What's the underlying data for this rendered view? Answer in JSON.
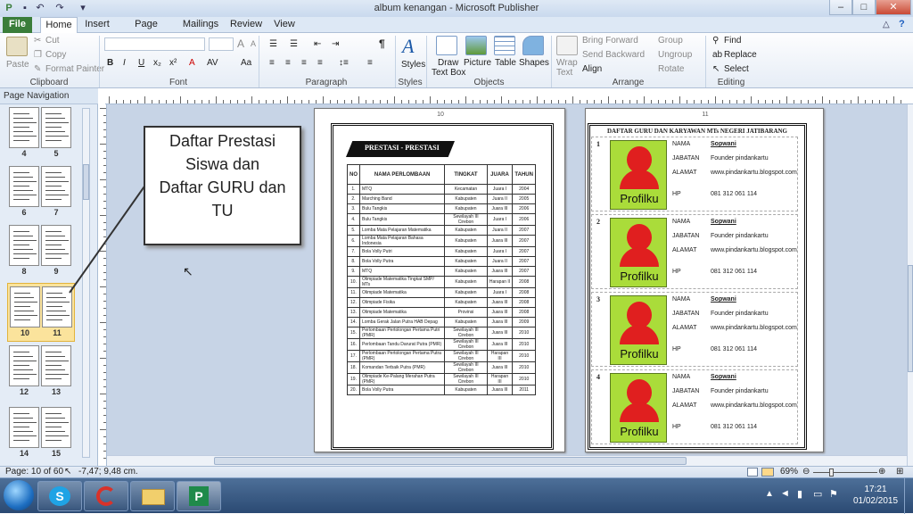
{
  "window": {
    "title": "album kenangan  -  Microsoft Publisher",
    "controls": [
      "–",
      "□",
      "✕"
    ]
  },
  "tabs": [
    "File",
    "Home",
    "Insert",
    "Page Design",
    "Mailings",
    "Review",
    "View"
  ],
  "ribbon": {
    "clipboard": {
      "group": "Clipboard",
      "paste": "Paste",
      "cut": "Cut",
      "copy": "Copy",
      "format_painter": "Format Painter"
    },
    "font": {
      "group": "Font",
      "bold": "B",
      "italic": "I",
      "underline": "U",
      "sub": "x₂",
      "super": "x²",
      "grow": "A",
      "shrink": "A"
    },
    "paragraph": {
      "group": "Paragraph",
      "pilcrow": "¶"
    },
    "styles": {
      "group": "Styles",
      "label": "Styles"
    },
    "objects": {
      "group": "Objects",
      "draw_text_box_1": "Draw",
      "draw_text_box_2": "Text Box",
      "picture": "Picture",
      "table": "Table",
      "shapes": "Shapes"
    },
    "arrange": {
      "group": "Arrange",
      "wrap_1": "Wrap",
      "wrap_2": "Text",
      "bring_forward": "Bring Forward",
      "send_backward": "Send Backward",
      "align": "Align",
      "group_btn": "Group",
      "ungroup": "Ungroup",
      "rotate": "Rotate"
    },
    "editing": {
      "group": "Editing",
      "find": "Find",
      "replace": "Replace",
      "select": "Select"
    }
  },
  "navigation": {
    "title": "Page Navigation",
    "thumbnails": [
      {
        "left": "4",
        "right": "5"
      },
      {
        "left": "6",
        "right": "7"
      },
      {
        "left": "8",
        "right": "9"
      },
      {
        "left": "10",
        "right": "11"
      },
      {
        "left": "12",
        "right": "13"
      },
      {
        "left": "14",
        "right": "15"
      }
    ]
  },
  "callout": {
    "line1": "Daftar Prestasi",
    "line2": "Siswa dan",
    "line3": "Daftar GURU dan",
    "line4": "TU"
  },
  "page_left": {
    "number": "10",
    "heading": "PRESTASI  - PRESTASI",
    "columns": [
      "NO",
      "NAMA PERLOMBAAN",
      "TINGKAT",
      "JUARA",
      "TAHUN"
    ],
    "rows": [
      [
        "1.",
        "MTQ",
        "Kecamatan",
        "Juara I",
        "2004"
      ],
      [
        "2.",
        "Marching Band",
        "Kabupaten",
        "Juara II",
        "2005"
      ],
      [
        "3.",
        "Bulu Tangkis",
        "Kabupaten",
        "Juara III",
        "2006"
      ],
      [
        "4.",
        "Bulu Tangkis",
        "Sewilayah III Cirebon",
        "Juara I",
        "2006"
      ],
      [
        "5.",
        "Lomba Mata Pelajaran Matematika",
        "Kabupaten",
        "Juara II",
        "2007"
      ],
      [
        "6.",
        "Lomba Mata Pelajaran Bahasa Indonesia",
        "Kabupaten",
        "Juara III",
        "2007"
      ],
      [
        "7.",
        "Bola Volly Putri",
        "Kabupaten",
        "Juara I",
        "2007"
      ],
      [
        "8.",
        "Bola Volly Putra",
        "Kabupaten",
        "Juara II",
        "2007"
      ],
      [
        "9.",
        "MTQ",
        "Kabupaten",
        "Juara III",
        "2007"
      ],
      [
        "10.",
        "Olimpiade Matematika Tingkat SMP/ MTs",
        "Kabupaten",
        "Harapan II",
        "2008"
      ],
      [
        "11.",
        "Olimpiade Matematika",
        "Kabupaten",
        "Juara I",
        "2008"
      ],
      [
        "12.",
        "Olimpiade Fisika",
        "Kabupaten",
        "Juara III",
        "2008"
      ],
      [
        "13.",
        "Olimpiade Matematika",
        "Provinsi",
        "Juara III",
        "2008"
      ],
      [
        "14.",
        "Lomba Gerak Jalan Putra HAB Depag",
        "Kabupaten",
        "Juara III",
        "2009"
      ],
      [
        "15.",
        "Perlombaan Pertolongan Pertama Putri (PMR)",
        "Sewilayah III Cirebon",
        "Juara III",
        "2010"
      ],
      [
        "16.",
        "Perlombaan Tandu Darurat Putra (PMR)",
        "Sewilayah III Cirebon",
        "Juara III",
        "2010"
      ],
      [
        "17.",
        "Perlombaan Pertolongan Pertama Putra  (PMR)",
        "Sewilayah III Cirebon",
        "Harapan III",
        "2010"
      ],
      [
        "18.",
        "Komandan Terbaik Putra (PMR)",
        "Sewilayah III Cirebon",
        "Juara III",
        "2010"
      ],
      [
        "19.",
        "Olimpiade Ke-Palang Merahan Putra (PMR)",
        "Sewilayah III Cirebon",
        "Harapan III",
        "2010"
      ],
      [
        "20.",
        "Bola Volly Putra",
        "Kabupaten",
        "Juara III",
        "2011"
      ]
    ]
  },
  "page_right": {
    "number": "11",
    "heading": "DAFTAR GURU DAN KARYAWAN  MTs NEGERI  JATIBARANG",
    "profiles": [
      {
        "num": "1",
        "photo": "Profilku",
        "nama_label": "NAMA",
        "nama": "Sopwani",
        "jabatan_label": "JABATAN",
        "jabatan": "Founder pindankartu",
        "alamat_label": "ALAMAT",
        "alamat": "www.pindankartu.blogspot.com",
        "hp_label": "HP",
        "hp": "081 312 061 114"
      },
      {
        "num": "2",
        "photo": "Profilku",
        "nama_label": "NAMA",
        "nama": "Sopwani",
        "jabatan_label": "JABATAN",
        "jabatan": "Founder pindankartu",
        "alamat_label": "ALAMAT",
        "alamat": "www.pindankartu.blogspot.com",
        "hp_label": "HP",
        "hp": "081 312 061 114"
      },
      {
        "num": "3",
        "photo": "Profilku",
        "nama_label": "NAMA",
        "nama": "Sopwani",
        "jabatan_label": "JABATAN",
        "jabatan": "Founder pindankartu",
        "alamat_label": "ALAMAT",
        "alamat": "www.pindankartu.blogspot.com",
        "hp_label": "HP",
        "hp": "081 312 061 114"
      },
      {
        "num": "4",
        "photo": "Profilku",
        "nama_label": "NAMA",
        "nama": "Sopwani",
        "jabatan_label": "JABATAN",
        "jabatan": "Founder pindankartu",
        "alamat_label": "ALAMAT",
        "alamat": "www.pindankartu.blogspot.com",
        "hp_label": "HP",
        "hp": "081 312 061 114"
      }
    ]
  },
  "status": {
    "page": "Page: 10 of 60",
    "position": "-7,47; 9,48 cm.",
    "zoom": "69%"
  },
  "taskbar": {
    "time": "17:21",
    "date": "01/02/2015"
  },
  "colors": {
    "accent": "#3a7d3a",
    "photo_bg": "#aadc3a",
    "silhouette": "#e01f1f"
  }
}
